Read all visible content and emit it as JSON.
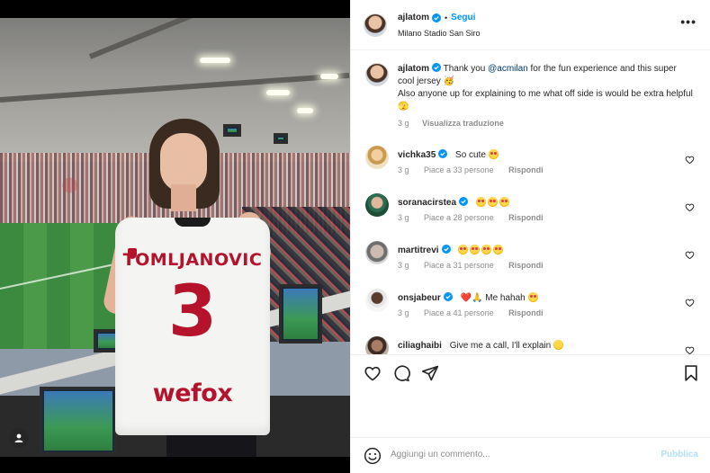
{
  "post": {
    "author": "ajlatom",
    "follow_label": "Segui",
    "separator": "•",
    "location": "Milano Stadio San Siro",
    "more_label": "•••"
  },
  "photo": {
    "jersey_name": "TOMLJANOVIC",
    "jersey_number": "3",
    "jersey_sponsor": "wefox"
  },
  "caption": {
    "username": "ajlatom",
    "text_before": "Thank you ",
    "mention": "@acmilan",
    "text_after": " for the fun experience and this super cool jersey 🥳",
    "text_line2": "Also anyone up for explaining to me what off side is would be extra helpful 🫣",
    "time": "3 g",
    "translate_label": "Visualizza traduzione"
  },
  "comments": [
    {
      "username": "vichka35",
      "text": "So cute",
      "emoji": [
        "heart-eyes"
      ],
      "time": "3 g",
      "likes": "Piace a 33 persone",
      "reply": "Rispondi"
    },
    {
      "username": "soranacirstea",
      "text": "",
      "emoji": [
        "heart-eyes",
        "heart-eyes",
        "heart-eyes"
      ],
      "time": "3 g",
      "likes": "Piace a 28 persone",
      "reply": "Rispondi"
    },
    {
      "username": "martitrevi",
      "text": "",
      "emoji": [
        "heart-eyes",
        "heart-eyes",
        "heart-eyes",
        "heart-eyes"
      ],
      "time": "3 g",
      "likes": "Piace a 31 persone",
      "reply": "Rispondi"
    },
    {
      "username": "onsjabeur",
      "text": "Me hahah",
      "prefix": "❤️🙏",
      "emoji": [
        "heart-eyes"
      ],
      "time": "3 g",
      "likes": "Piace a 41 persone",
      "reply": "Rispondi"
    },
    {
      "username": "ciliaghaibi",
      "text": "Give me a call, I'll explain",
      "emoji": [
        "smile"
      ]
    }
  ],
  "compose": {
    "placeholder": "Aggiungi un commento...",
    "publish_label": "Pubblica"
  },
  "colors": {
    "link": "#0095f6",
    "mention": "#00376b",
    "meta": "#8e8e8e",
    "jersey_red": "#b5122b"
  }
}
